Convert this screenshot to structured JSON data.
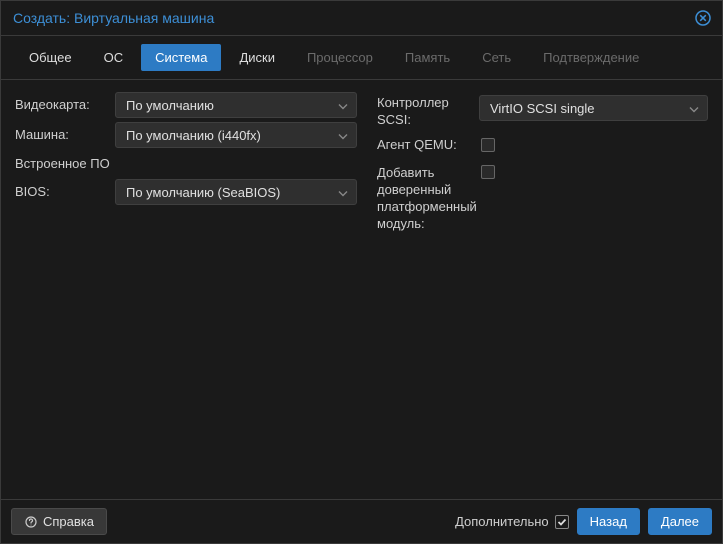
{
  "window": {
    "title": "Создать: Виртуальная машина"
  },
  "tabs": [
    {
      "label": "Общее",
      "state": "enabled"
    },
    {
      "label": "ОС",
      "state": "enabled"
    },
    {
      "label": "Система",
      "state": "active"
    },
    {
      "label": "Диски",
      "state": "enabled"
    },
    {
      "label": "Процессор",
      "state": "disabled"
    },
    {
      "label": "Память",
      "state": "disabled"
    },
    {
      "label": "Сеть",
      "state": "disabled"
    },
    {
      "label": "Подтверждение",
      "state": "disabled"
    }
  ],
  "form": {
    "graphics_label": "Видеокарта:",
    "graphics_value": "По умолчанию",
    "machine_label": "Машина:",
    "machine_value": "По умолчанию (i440fx)",
    "firmware_heading": "Встроенное ПО",
    "bios_label": "BIOS:",
    "bios_value": "По умолчанию (SeaBIOS)",
    "scsi_label": "Контроллер SCSI:",
    "scsi_value": "VirtIO SCSI single",
    "qemu_agent_label": "Агент QEMU:",
    "qemu_agent_checked": false,
    "tpm_label": "Добавить доверенный платформенный модуль:",
    "tpm_checked": false
  },
  "footer": {
    "help_label": "Справка",
    "advanced_label": "Дополнительно",
    "advanced_checked": true,
    "back_label": "Назад",
    "next_label": "Далее"
  }
}
